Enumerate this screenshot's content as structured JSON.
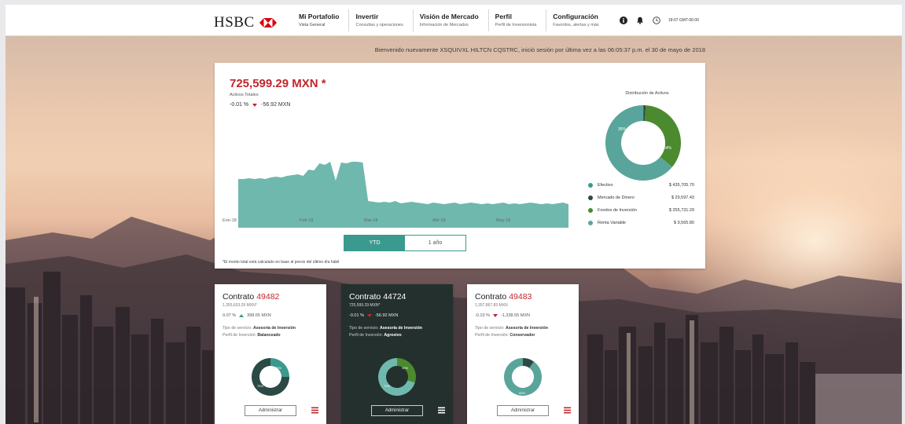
{
  "brand": {
    "name": "HSBC",
    "primary": "#db0011",
    "accent": "#3a9a8e"
  },
  "nav": [
    {
      "title": "Mi Portafolio",
      "sub": "Vista General"
    },
    {
      "title": "Invertir",
      "sub": "Consultas y operaciones"
    },
    {
      "title": "Visión de Mercado",
      "sub": "Información de Mercados"
    },
    {
      "title": "Perfil",
      "sub": "Perfil de Inversionista"
    },
    {
      "title": "Configuración",
      "sub": "Favoritos, alertas y más"
    }
  ],
  "utility": {
    "info_icon": "info-icon",
    "bell_icon": "bell-icon",
    "clock_icon": "clock-icon",
    "time": "18:07 GMT-06:00"
  },
  "welcome": "Bienvenido nuevamente XSQUIVXL HILTCN CQSTRC, inició sesión por última vez a las 06:05:37 p.m. el 30 de mayo de 2018",
  "summary": {
    "total": "725,599.29 MXN *",
    "total_label": "Activos Totales",
    "change_pct": "-0.01 %",
    "change_amt": "-56.92 MXN"
  },
  "chart_data": [
    {
      "type": "area",
      "x_labels": [
        "Ene-18",
        "Feb-18",
        "Mar-18",
        "Abr-18",
        "May-18"
      ],
      "values": [
        62,
        62,
        63,
        62,
        63,
        62,
        64,
        65,
        64,
        66,
        67,
        68,
        66,
        74,
        73,
        82,
        80,
        84,
        60,
        83,
        82,
        84,
        84,
        83,
        34,
        33,
        32,
        33,
        32,
        34,
        31,
        32,
        33,
        32,
        31,
        30,
        32,
        31,
        30,
        31,
        32,
        30,
        31,
        32,
        31,
        30,
        31,
        30,
        31,
        32,
        30,
        31,
        30,
        31,
        32,
        31,
        30,
        31,
        30,
        31,
        32,
        30
      ],
      "color": "#6fb8ad"
    },
    {
      "type": "pie",
      "title": "Distribución de Activos",
      "slices": [
        {
          "label": "Efectivo",
          "value": 0.1,
          "color": "#3a9a8e",
          "amount": "$ 435,705.70"
        },
        {
          "label": "Mercado de Dinero",
          "value": 1,
          "color": "#2c4a45",
          "amount": "$ 29,597.43"
        },
        {
          "label": "Fondos de Inversión",
          "value": 35,
          "color": "#4b8a2e",
          "amount": "$ 255,731.29"
        },
        {
          "label": "Renta Variable",
          "value": 64,
          "color": "#5aa59b",
          "amount": "$ 9,565.80"
        }
      ],
      "slice_labels": [
        "35%",
        "64%"
      ]
    }
  ],
  "toggle": {
    "ytd": "YTD",
    "year": "1 año"
  },
  "footnote": "*El monto total está calculado en base al precio del último día hábil",
  "contracts": [
    {
      "prefix": "Contrato",
      "number": "49482",
      "amount": "1,355,633.29 MXN*",
      "change_pct": "0.07 %",
      "change_amt": "398.65 MXN",
      "direction": "up",
      "service_label": "Tipo de servicio:",
      "service": "Asesoría de Inversión",
      "profile_label": "Perfil de Inversión:",
      "profile": "Balanceado",
      "donut": [
        {
          "value": 25,
          "color": "#3a9a8e"
        },
        {
          "value": 75,
          "color": "#2c4a45"
        }
      ],
      "donut_labels": [
        "25%",
        "75%"
      ],
      "admin": "Administrar",
      "style": "light"
    },
    {
      "prefix": "Contrato",
      "number": "44724",
      "amount": "725,599.29 MXN*",
      "change_pct": "-0.01 %",
      "change_amt": "-56.92 MXN",
      "direction": "down",
      "service_label": "Tipo de servicio:",
      "service": "Asesoría de Inversión",
      "profile_label": "Perfil de Inversión:",
      "profile": "Agresivo",
      "donut": [
        {
          "value": 30,
          "color": "#4b8a2e"
        },
        {
          "value": 70,
          "color": "#6fb8ad"
        }
      ],
      "donut_labels": [
        "30%",
        "70%"
      ],
      "admin": "Administrar",
      "style": "dark"
    },
    {
      "prefix": "Contrato",
      "number": "49483",
      "amount": "1,357,867.83 MXN",
      "change_pct": "-0.10 %",
      "change_amt": "-1,338.55 MXN",
      "direction": "down",
      "service_label": "Tipo de servicio:",
      "service": "Asesoría de Inversión",
      "profile_label": "Perfil de Inversión:",
      "profile": "Conservador",
      "donut": [
        {
          "value": 10,
          "color": "#2c4a45"
        },
        {
          "value": 90,
          "color": "#5aa59b"
        }
      ],
      "donut_labels": [
        "90%"
      ],
      "admin": "Administrar",
      "style": "light"
    }
  ]
}
